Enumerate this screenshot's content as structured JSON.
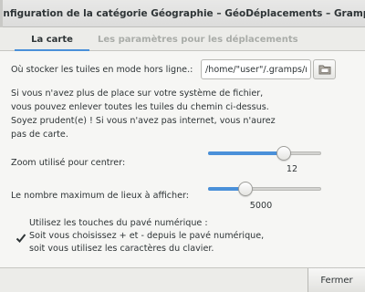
{
  "window": {
    "title": "Configuration de la catégorie Géographie – GéoDéplacements – Gramps"
  },
  "tabs": [
    {
      "label": "La carte",
      "active": true
    },
    {
      "label": "Les paramètres pour les déplacements",
      "active": false
    }
  ],
  "tiles": {
    "label": "Où stocker les tuiles en mode hors ligne.:",
    "path_value": "/home/\"user\"/.gramps/ma",
    "folder_icon": "folder-icon"
  },
  "info_lines": [
    "Si vous n'avez plus de place sur votre système de fichier,",
    "vous pouvez enlever toutes les tuiles du chemin ci-dessus.",
    "Soyez prudent(e) ! Si vous n'avez pas internet, vous n'aurez",
    "pas de carte."
  ],
  "zoom": {
    "label": "Zoom utilisé pour centrer:",
    "value": "12",
    "fraction": 0.67
  },
  "max_places": {
    "label": "Le nombre maximum de lieux à afficher:",
    "value": "5000",
    "fraction": 0.33
  },
  "keypad": {
    "checked": true,
    "lines": [
      "Utilisez les touches du pavé numérique :",
      "Soit vous choisissez + et - depuis le pavé numérique,",
      "soit vous utilisez les caractères du clavier."
    ]
  },
  "footer": {
    "close_label": "Fermer"
  },
  "colors": {
    "accent": "#4a90d9",
    "titlebar": "#dcdcdb",
    "background": "#f6f6f4"
  }
}
